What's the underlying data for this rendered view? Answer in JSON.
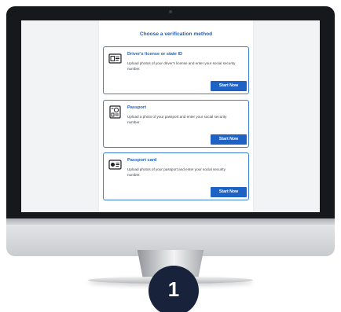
{
  "panel": {
    "title": "Choose a verification method"
  },
  "methods": [
    {
      "title": "Driver's license or state ID",
      "description": "Upload photos of your driver's license and enter your social security number.",
      "button": "Start Now",
      "icon": "id-card-icon"
    },
    {
      "title": "Passport",
      "description": "Upload a photo of your passport and enter your social security number.",
      "button": "Start Now",
      "icon": "passport-icon"
    },
    {
      "title": "Passport card",
      "description": "Upload photos of your passport and enter your social security number.",
      "button": "Start Now",
      "icon": "passport-card-icon"
    }
  ],
  "step_badge": "1",
  "colors": {
    "accent": "#1f62c6",
    "title": "#1f5fbf",
    "badge": "#18233b"
  }
}
